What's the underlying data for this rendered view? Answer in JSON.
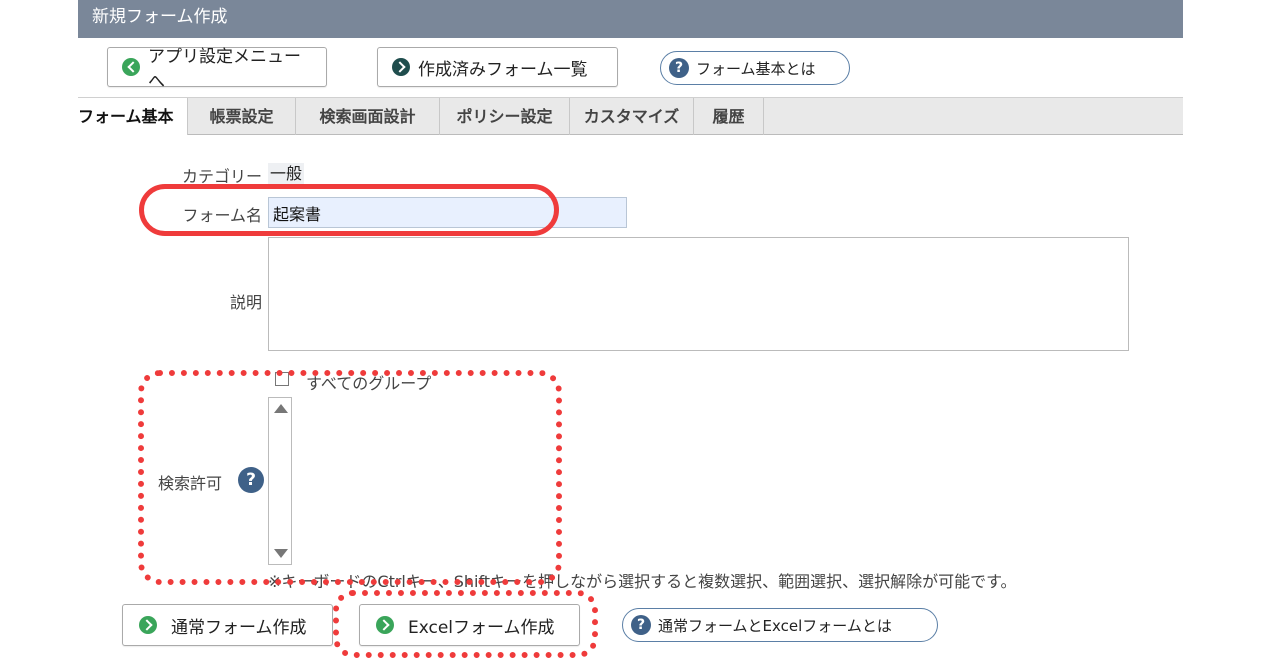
{
  "header": {
    "title": "新規フォーム作成"
  },
  "toolbar": {
    "app_settings_label": "アプリ設定メニューへ",
    "form_list_label": "作成済みフォーム一覧",
    "help_label": "フォーム基本とは"
  },
  "tabs": [
    {
      "label": "フォーム基本",
      "active": true
    },
    {
      "label": "帳票設定"
    },
    {
      "label": "検索画面設計"
    },
    {
      "label": "ポリシー設定"
    },
    {
      "label": "カスタマイズ"
    },
    {
      "label": "履歴"
    }
  ],
  "form": {
    "category_label": "カテゴリー",
    "category_value": "一般",
    "name_label": "フォーム名",
    "name_value": "起案書",
    "description_label": "説明",
    "description_value": "",
    "search_permission_label": "検索許可",
    "all_groups_label": "すべてのグループ",
    "note": "※キーボードのCtrlキー、Shiftキーを押しながら選択すると複数選択、範囲選択、選択解除が可能です。"
  },
  "actions": {
    "normal_form_label": "通常フォーム作成",
    "excel_form_label": "Excelフォーム作成",
    "help_label": "通常フォームとExcelフォームとは"
  },
  "colors": {
    "annotation": "#ef3b3b",
    "titlebar": "#7a8799",
    "accent_green": "#3aa55a",
    "help_blue": "#3f6188"
  }
}
